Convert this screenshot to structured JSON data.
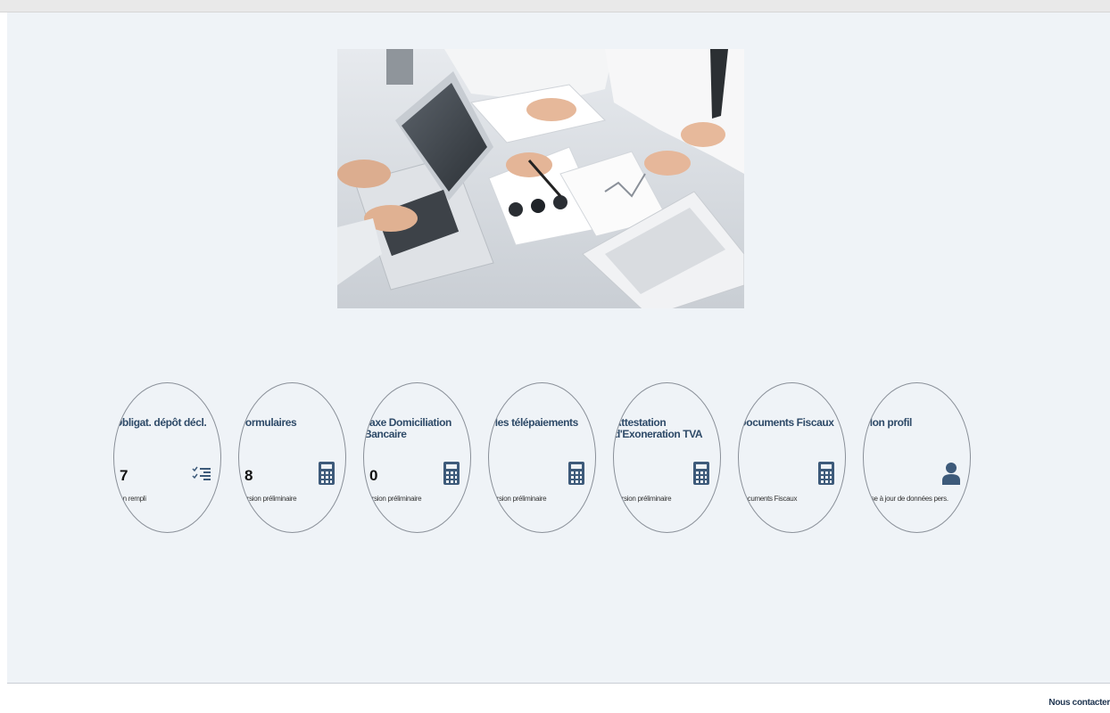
{
  "tiles": [
    {
      "title": "Obligat. dépôt décl.",
      "count": "7",
      "subtitle": "Non rempli",
      "icon": "checklist-icon"
    },
    {
      "title": "Formulaires",
      "count": "8",
      "subtitle": "Version préliminaire",
      "icon": "calculator-icon"
    },
    {
      "title": "Taxe Domiciliation Bancaire",
      "count": "0",
      "subtitle": "Version préliminaire",
      "icon": "calculator-icon"
    },
    {
      "title": "Mes télépaiements",
      "count": "",
      "subtitle": "Version préliminaire",
      "icon": "calculator-icon"
    },
    {
      "title": "Attestation d'Exoneration TVA",
      "count": "",
      "subtitle": "Version préliminaire",
      "icon": "calculator-icon"
    },
    {
      "title": "Documents Fiscaux",
      "count": "",
      "subtitle": "Documents Fiscaux",
      "icon": "calculator-icon"
    },
    {
      "title": "Mon profil",
      "count": "",
      "subtitle": "Mise à jour de données pers.",
      "icon": "user-icon"
    }
  ],
  "footer": {
    "contact_label": "Nous contacter"
  },
  "colors": {
    "accent": "#3d5a7a",
    "background": "#eff3f7",
    "title": "#2e4a68"
  }
}
